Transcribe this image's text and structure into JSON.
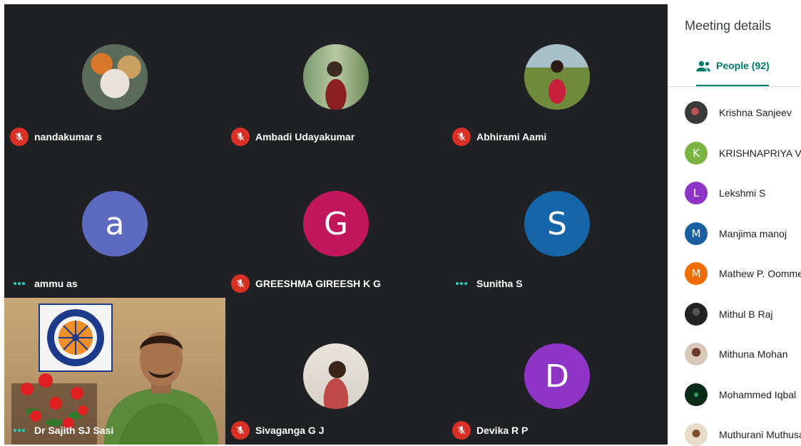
{
  "tiles": [
    {
      "name": "nandakumar s",
      "status": "muted"
    },
    {
      "name": "Ambadi Udayakumar",
      "status": "muted"
    },
    {
      "name": "Abhirami Aami",
      "status": "muted"
    },
    {
      "name": "ammu as",
      "status": "speaking",
      "initial": "a"
    },
    {
      "name": "GREESHMA GIREESH K G",
      "status": "muted",
      "initial": "G"
    },
    {
      "name": "Sunitha S",
      "status": "speaking",
      "initial": "S"
    },
    {
      "name": "Dr Sajith SJ Sasi",
      "status": "speaking",
      "video": true
    },
    {
      "name": "Sivaganga G J",
      "status": "muted"
    },
    {
      "name": "Devika R P",
      "status": "muted",
      "initial": "D"
    }
  ],
  "panel": {
    "title": "Meeting details",
    "people_tab": "People (92)"
  },
  "people": [
    {
      "name": "Krishna Sanjeev",
      "initial": ""
    },
    {
      "name": "KRISHNAPRIYA V S",
      "initial": "K"
    },
    {
      "name": "Lekshmi S",
      "initial": "L"
    },
    {
      "name": "Manjima manoj",
      "initial": "M"
    },
    {
      "name": "Mathew P. Oommen",
      "initial": "M"
    },
    {
      "name": "Mithul B Raj",
      "initial": ""
    },
    {
      "name": "Mithuna Mohan",
      "initial": ""
    },
    {
      "name": "Mohammed Iqbal",
      "initial": ""
    },
    {
      "name": "Muthurani Muthusamy",
      "initial": ""
    }
  ],
  "colors": {
    "grid_bg": "#202124",
    "mic_off": "#d93025",
    "speaking_dots": "#1ad7c0",
    "accent": "#00796b"
  },
  "icons": [
    "mic-off-icon",
    "speaking-dots-icon",
    "people-icon"
  ]
}
